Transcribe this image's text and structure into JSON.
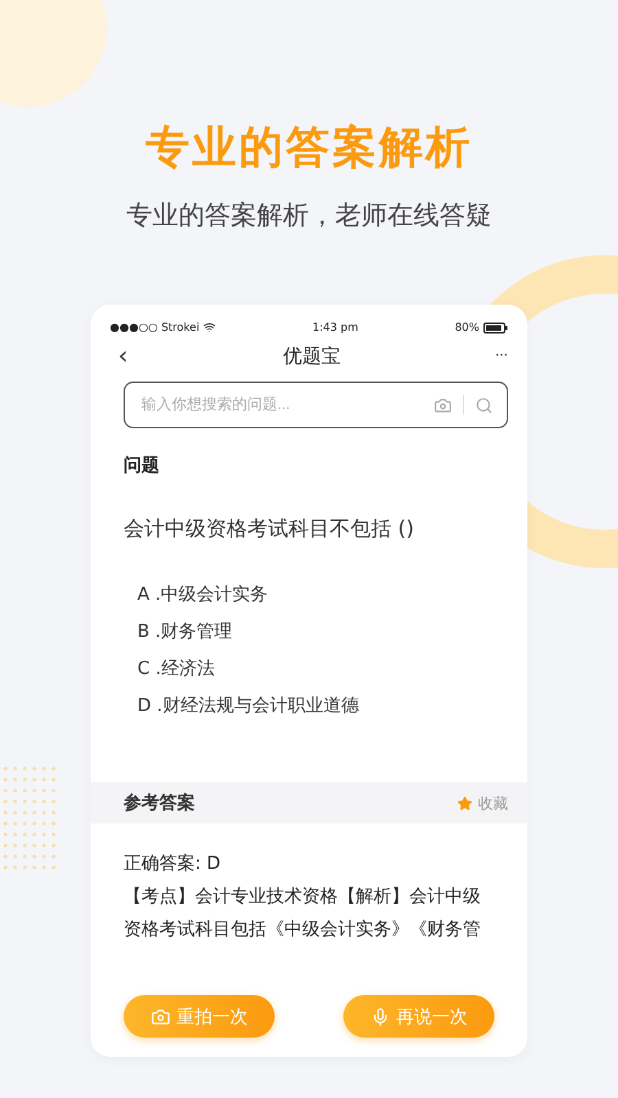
{
  "headline": "专业的答案解析",
  "subtitle": "专业的答案解析，老师在线答疑",
  "phone": {
    "status_bar": {
      "carrier": "●●●○○ Strokei",
      "time": "1:43 pm",
      "battery": "80%"
    },
    "nav": {
      "back": "‹",
      "title": "优题宝",
      "more": "···"
    },
    "search": {
      "placeholder": "输入你想搜索的问题..."
    },
    "question_label": "问题",
    "question": "会计中级资格考试科目不包括 ()",
    "options": [
      {
        "text": "A .中级会计实务"
      },
      {
        "text": "B .财务管理"
      },
      {
        "text": "C .经济法"
      },
      {
        "text": "D .财经法规与会计职业道德"
      }
    ],
    "answer_header": {
      "title": "参考答案",
      "favorite": "收藏"
    },
    "answer_lines": [
      "正确答案: D",
      "【考点】会计专业技术资格【解析】会计中级",
      "资格考试科目包括《中级会计实务》《财务管"
    ],
    "buttons": [
      {
        "kind": "camera",
        "label": "重拍一次"
      },
      {
        "kind": "mic",
        "label": "再说一次"
      }
    ]
  }
}
